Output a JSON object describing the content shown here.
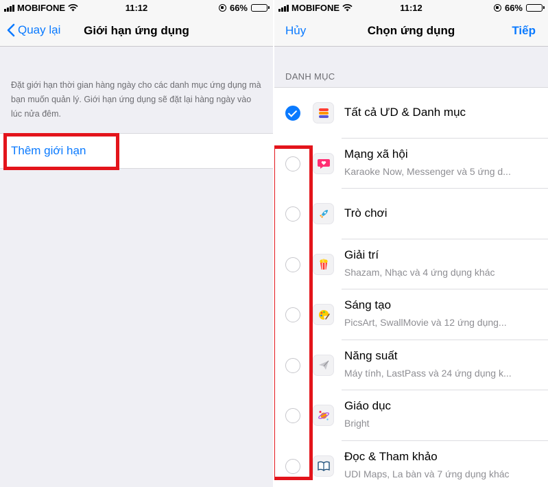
{
  "status_bar": {
    "carrier": "MOBIFONE",
    "time": "11:12",
    "battery": "66%",
    "battery_level": 0.66
  },
  "left_screen": {
    "nav": {
      "back_label": "Quay lại",
      "title": "Giới hạn ứng dụng"
    },
    "description": "Đặt giới hạn thời gian hàng ngày cho các danh mục ứng dụng mà bạn muốn quản lý. Giới hạn ứng dụng sẽ đặt lại hàng ngày vào lúc nửa đêm.",
    "add_limit_label": "Thêm giới hạn"
  },
  "right_screen": {
    "nav": {
      "cancel_label": "Hủy",
      "title": "Chọn ứng dụng",
      "next_label": "Tiếp"
    },
    "section_header": "DANH MỤC",
    "categories": [
      {
        "name": "Tất cả ƯD & Danh mục",
        "subtitle": "",
        "icon": "stack-icon",
        "checked": true
      },
      {
        "name": "Mạng xã hội",
        "subtitle": "Karaoke Now, Messenger và 5 ứng d...",
        "icon": "chat-heart-icon",
        "checked": false
      },
      {
        "name": "Trò chơi",
        "subtitle": "",
        "icon": "rocket-icon",
        "checked": false
      },
      {
        "name": "Giải trí",
        "subtitle": "Shazam, Nhạc và 4 ứng dụng khác",
        "icon": "popcorn-icon",
        "checked": false
      },
      {
        "name": "Sáng tạo",
        "subtitle": "PicsArt, SwallMovie và 12 ứng dụng...",
        "icon": "palette-icon",
        "checked": false
      },
      {
        "name": "Năng suất",
        "subtitle": "Máy tính, LastPass và 24 ứng dụng k...",
        "icon": "paper-plane-icon",
        "checked": false
      },
      {
        "name": "Giáo dục",
        "subtitle": "Bright",
        "icon": "planet-icon",
        "checked": false
      },
      {
        "name": "Đọc & Tham khảo",
        "subtitle": "UDI Maps, La bàn và 7 ứng dụng khác",
        "icon": "book-icon",
        "checked": false
      }
    ]
  },
  "colors": {
    "accent": "#0a7aff",
    "highlight": "#e3141b",
    "background": "#efeff4"
  }
}
